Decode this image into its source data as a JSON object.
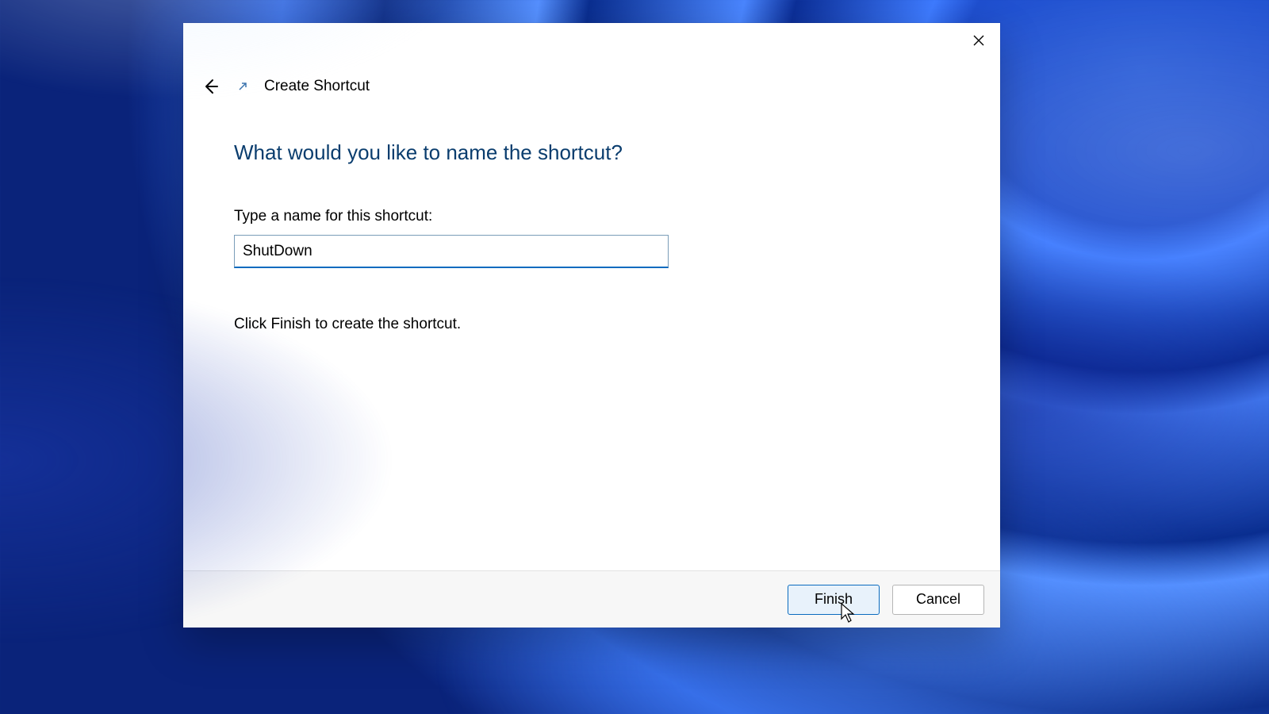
{
  "dialog": {
    "title": "Create Shortcut",
    "heading": "What would you like to name the shortcut?",
    "label": "Type a name for this shortcut:",
    "input_value": "ShutDown",
    "instruction": "Click Finish to create the shortcut.",
    "buttons": {
      "primary": "Finish",
      "cancel": "Cancel"
    }
  }
}
